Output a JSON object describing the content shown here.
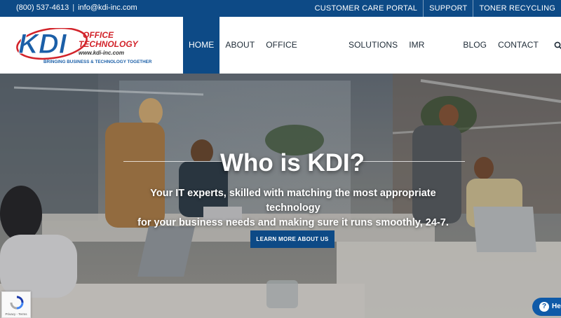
{
  "topbar": {
    "phone": "(800) 537-4613",
    "separator": "|",
    "email": "info@kdi-inc.com",
    "links": [
      "CUSTOMER CARE PORTAL",
      "SUPPORT",
      "TONER RECYCLING"
    ]
  },
  "logo": {
    "mark": "KDI",
    "brand_line1": "OFFICE",
    "brand_line2": "TECHNOLOGY",
    "website": "www.kdi-inc.com",
    "slogan": "BRINGING BUSINESS & TECHNOLOGY TOGETHER"
  },
  "nav": {
    "items": [
      "HOME",
      "ABOUT",
      "OFFICE EQUIPMENT",
      "SOLUTIONS",
      "IMR DIGITAL",
      "BLOG",
      "CONTACT US"
    ],
    "active": "HOME",
    "search_icon": "search-icon"
  },
  "hero": {
    "title": "Who is KDI?",
    "tagline_line1": "Your IT experts, skilled with matching the most appropriate technology",
    "tagline_line2": "for your business needs and making sure it runs smoothly, 24-7.",
    "cta": "LEARN MORE ABOUT US"
  },
  "recaptcha": {
    "label": "Privacy - Terms"
  },
  "help": {
    "label": "He",
    "icon": "question-icon"
  },
  "colors": {
    "brand_blue": "#0d4a86",
    "logo_red": "#d2232a",
    "logo_blue": "#1b5fa8"
  }
}
